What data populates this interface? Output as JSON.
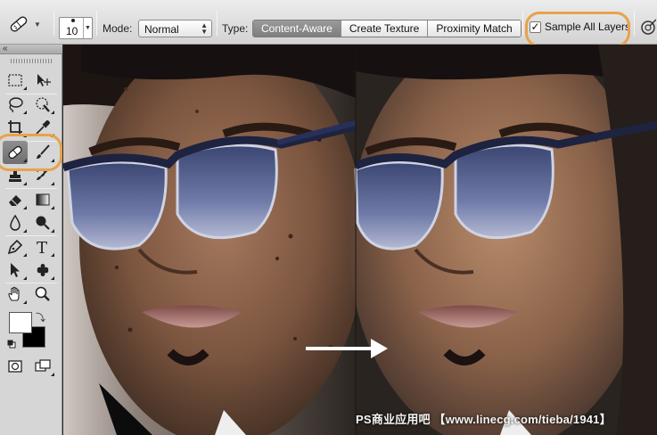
{
  "options_bar": {
    "tool_preset_icon": "spot-healing-brush-icon",
    "brush_size": "10",
    "mode_label": "Mode:",
    "mode_value": "Normal",
    "type_label": "Type:",
    "type_options": [
      "Content-Aware",
      "Create Texture",
      "Proximity Match"
    ],
    "type_selected": "Content-Aware",
    "sample_all_layers_label": "Sample All Layers",
    "sample_all_layers_checked": true,
    "pressure_icon": "tablet-pressure-icon"
  },
  "tools": {
    "collapse_glyph": "«",
    "active_tool": "spot-healing-brush-icon",
    "items": [
      "rectangular-marquee-icon",
      "move-icon",
      "lasso-icon",
      "quick-selection-icon",
      "crop-icon",
      "eyedropper-icon",
      "spot-healing-brush-icon",
      "brush-icon",
      "clone-stamp-icon",
      "history-brush-icon",
      "eraser-icon",
      "gradient-icon",
      "blur-icon",
      "dodge-icon",
      "pen-icon",
      "type-icon",
      "path-selection-icon",
      "custom-shape-icon",
      "hand-icon",
      "zoom-icon",
      "quick-mask-icon",
      "screen-mode-icon"
    ],
    "type_tool_glyph": "T",
    "foreground_color": "#ffffff",
    "background_color": "#000000"
  },
  "canvas": {
    "arrow_icon": "right-arrow-icon",
    "watermark": "PS商业应用吧 【www.linecg.com/tieba/1941】"
  },
  "colors": {
    "highlight": "#e8a24a",
    "active_segment": "#8a8a8a"
  }
}
